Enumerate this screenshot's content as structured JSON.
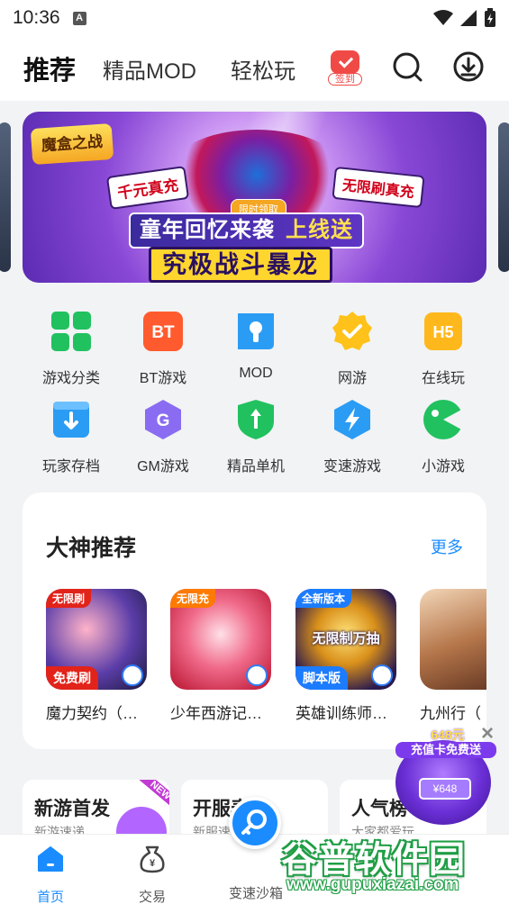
{
  "status_bar": {
    "time": "10:36",
    "notification_badge": "A"
  },
  "top_nav": {
    "tabs": [
      {
        "label": "推荐",
        "active": true
      },
      {
        "label": "精品MOD",
        "active": false
      },
      {
        "label": "轻松玩",
        "active": false
      }
    ],
    "signin_label": "签到"
  },
  "banner": {
    "logo_text": "魔盒之战",
    "tag_left": "千元真充",
    "tag_right": "无限刷真充",
    "limited_tag": "限时领取",
    "headline_part1": "童年回忆来袭",
    "headline_part2": "上线送",
    "headline_line2": "究极战斗暴龙"
  },
  "quick_links": [
    {
      "label": "游戏分类",
      "icon": "grid-icon",
      "color": "#21c15f"
    },
    {
      "label": "BT游戏",
      "icon": "bt-icon",
      "color": "#ff5b2e"
    },
    {
      "label": "MOD",
      "icon": "mod-icon",
      "color": "#2b9cf4"
    },
    {
      "label": "网游",
      "icon": "online-icon",
      "color": "#ffc21a"
    },
    {
      "label": "在线玩",
      "icon": "h5-icon",
      "color": "#ffb81c"
    },
    {
      "label": "玩家存档",
      "icon": "archive-icon",
      "color": "#2b9cf4"
    },
    {
      "label": "GM游戏",
      "icon": "gm-icon",
      "color": "#8a6cf2"
    },
    {
      "label": "精品单机",
      "icon": "single-icon",
      "color": "#21c15f"
    },
    {
      "label": "变速游戏",
      "icon": "speed-icon",
      "color": "#2b9cf4"
    },
    {
      "label": "小游戏",
      "icon": "mini-game-icon",
      "color": "#21c15f"
    }
  ],
  "recommend": {
    "title": "大神推荐",
    "more": "更多",
    "games": [
      {
        "name": "魔力契约（…",
        "badge": "无限刷",
        "bottom": "免费刷"
      },
      {
        "name": "少年西游记…",
        "badge": "无限充",
        "bottom": ""
      },
      {
        "name": "英雄训练师…",
        "badge": "全新版本",
        "bottom": "脚本版",
        "art_text": "无限制万抽"
      },
      {
        "name": "九州行（",
        "badge": "",
        "bottom": ""
      }
    ]
  },
  "promos": [
    {
      "title": "新游首发",
      "subtitle": "新游速递",
      "corner": "NEW"
    },
    {
      "title": "开服表",
      "subtitle": "新服速递"
    },
    {
      "title": "人气榜",
      "subtitle": "大家都爱玩"
    }
  ],
  "float_ad": {
    "amount": "648元",
    "text": "充值卡免费送",
    "card": "¥648"
  },
  "tab_bar": [
    {
      "label": "首页",
      "active": true
    },
    {
      "label": "交易",
      "active": false
    },
    {
      "label": "变速沙箱",
      "active": false
    }
  ],
  "watermark": {
    "main": "谷普软件园",
    "url": "www.gupuxiazai.com"
  }
}
